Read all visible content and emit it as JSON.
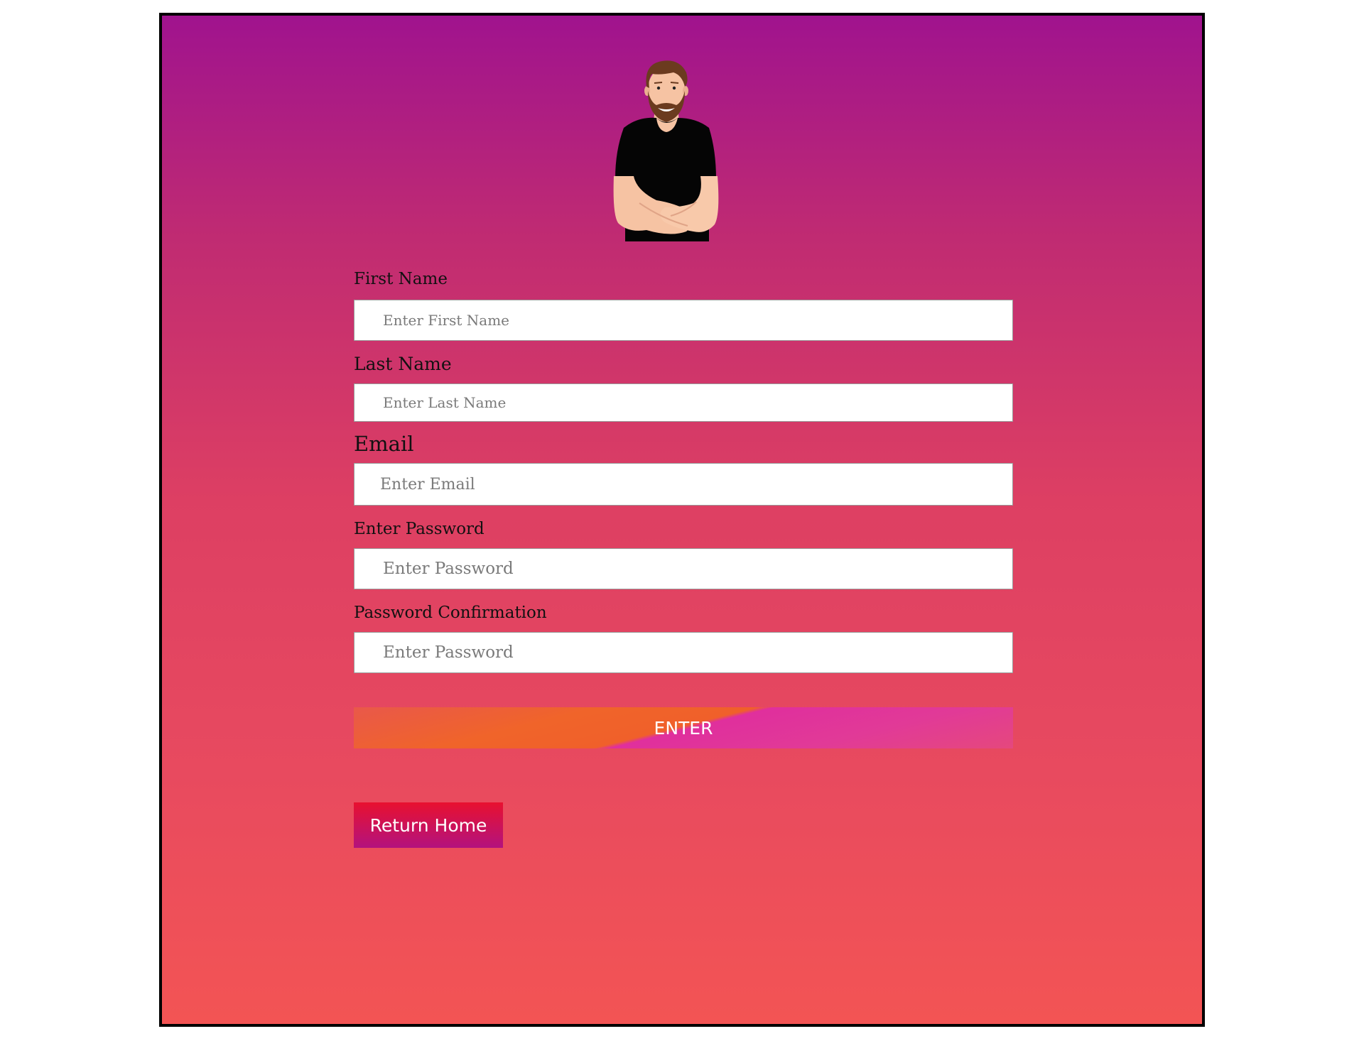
{
  "form": {
    "first_name": {
      "label": "First Name",
      "placeholder": "Enter First Name"
    },
    "last_name": {
      "label": "Last Name",
      "placeholder": "Enter Last Name"
    },
    "email": {
      "label": "Email",
      "placeholder": "Enter Email"
    },
    "password": {
      "label": "Enter Password",
      "placeholder": "Enter Password"
    },
    "password_confirmation": {
      "label": "Password Confirmation",
      "placeholder": "Enter Password"
    },
    "submit_label": "ENTER"
  },
  "return_home_label": "Return Home",
  "icons": {
    "avatar": "man-avatar-illustration"
  },
  "colors": {
    "background_top": "#a0138e",
    "background_bottom": "#f35454",
    "enter_orange": "#f0642a",
    "enter_magenta": "#e02f9d",
    "return_home_top": "#e8112f",
    "return_home_bottom": "#b3127e"
  }
}
